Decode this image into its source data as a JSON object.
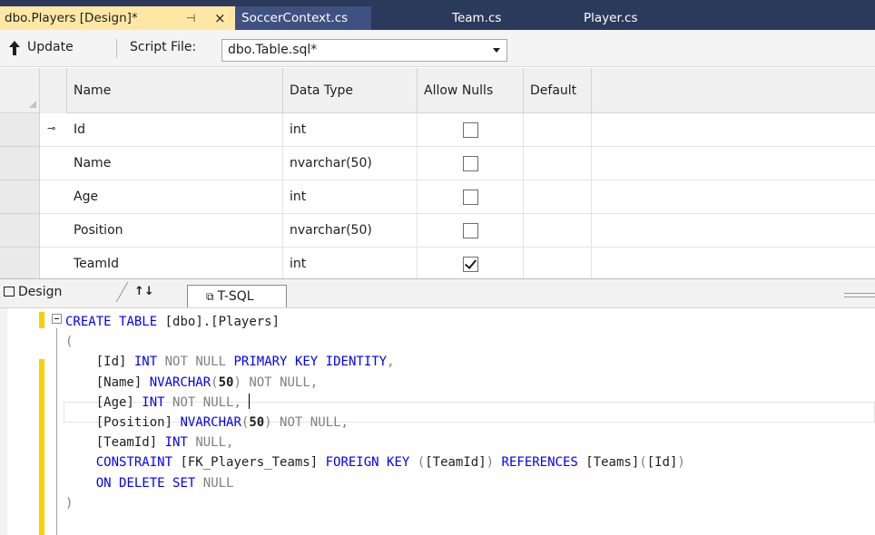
{
  "tabs": [
    {
      "label": "dbo.Players [Design]*",
      "active": true,
      "pin_glyph": "⊣",
      "close_glyph": "×"
    },
    {
      "label": "SoccerContext.cs",
      "active": false
    },
    {
      "label": "Team.cs",
      "active": false
    },
    {
      "label": "Player.cs",
      "active": false
    }
  ],
  "toolbar": {
    "update_label": "Update",
    "script_file_label": "Script File:",
    "script_file_value": "dbo.Table.sql*"
  },
  "grid": {
    "headers": {
      "name": "Name",
      "data_type": "Data Type",
      "allow_nulls": "Allow Nulls",
      "default": "Default"
    },
    "rows": [
      {
        "name": "Id",
        "data_type": "int",
        "allow_nulls": false,
        "primary_key": true
      },
      {
        "name": "Name",
        "data_type": "nvarchar(50)",
        "allow_nulls": false,
        "primary_key": false
      },
      {
        "name": "Age",
        "data_type": "int",
        "allow_nulls": false,
        "primary_key": false
      },
      {
        "name": "Position",
        "data_type": "nvarchar(50)",
        "allow_nulls": false,
        "primary_key": false
      },
      {
        "name": "TeamId",
        "data_type": "int",
        "allow_nulls": true,
        "primary_key": false
      }
    ]
  },
  "pane_tabs": {
    "design": "Design",
    "swap": "↑↓",
    "tsql": "T-SQL"
  },
  "code": {
    "lines": [
      "CREATE TABLE [dbo].[Players]",
      "(",
      "    [Id] INT NOT NULL PRIMARY KEY IDENTITY,",
      "    [Name] NVARCHAR(50) NOT NULL,",
      "    [Age] INT NOT NULL,",
      "    [Position] NVARCHAR(50) NOT NULL,",
      "    [TeamId] INT NULL,",
      "    CONSTRAINT [FK_Players_Teams] FOREIGN KEY ([TeamId]) REFERENCES [Teams]([Id])",
      "    ON DELETE SET NULL",
      ")"
    ]
  },
  "colors": {
    "tab_active": "#ffe8a6",
    "tab_strip": "#2b3a5a",
    "keyword": "#0000ff",
    "gray_keyword": "#808080",
    "change_bar": "#f7d100"
  }
}
